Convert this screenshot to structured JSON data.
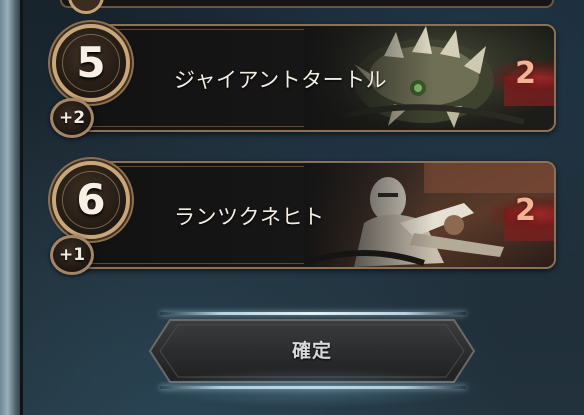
{
  "cards": [
    {
      "cost": "5",
      "bonus": "+2",
      "name": "ジャイアントタートル",
      "count": "2",
      "art_icon": "giant-turtle-art"
    },
    {
      "cost": "6",
      "bonus": "+1",
      "name": "ランツクネヒト",
      "count": "2",
      "art_icon": "landsknecht-art"
    }
  ],
  "confirm": {
    "label": "確定"
  },
  "colors": {
    "frame_gold": "#c8a679",
    "count_red": "#f2b393",
    "name_text": "#f4eee3",
    "background": "#1d2a33"
  }
}
